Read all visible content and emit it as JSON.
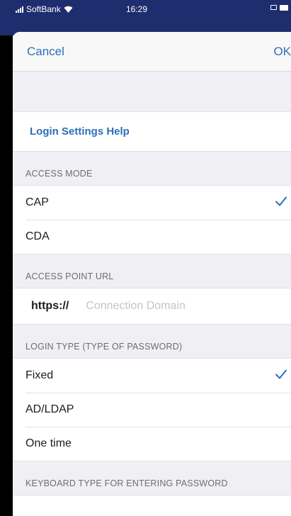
{
  "status_bar": {
    "carrier": "SoftBank",
    "time": "16:29"
  },
  "nav": {
    "cancel_label": "Cancel",
    "ok_label": "OK"
  },
  "help_link": "Login Settings Help",
  "access_mode": {
    "header": "ACCESS MODE",
    "options": [
      "CAP",
      "CDA"
    ],
    "selected": "CAP"
  },
  "access_point": {
    "header": "ACCESS POINT URL",
    "prefix": "https://",
    "value": "",
    "placeholder": "Connection Domain"
  },
  "login_type": {
    "header": "LOGIN TYPE (TYPE OF PASSWORD)",
    "options": [
      "Fixed",
      "AD/LDAP",
      "One time"
    ],
    "selected": "Fixed"
  },
  "keyboard_type": {
    "header": "KEYBOARD TYPE FOR ENTERING PASSWORD"
  },
  "colors": {
    "accent": "#2d6fb6",
    "status_bar_bg": "#1d2d6e",
    "grouped_bg": "#efeff4"
  }
}
